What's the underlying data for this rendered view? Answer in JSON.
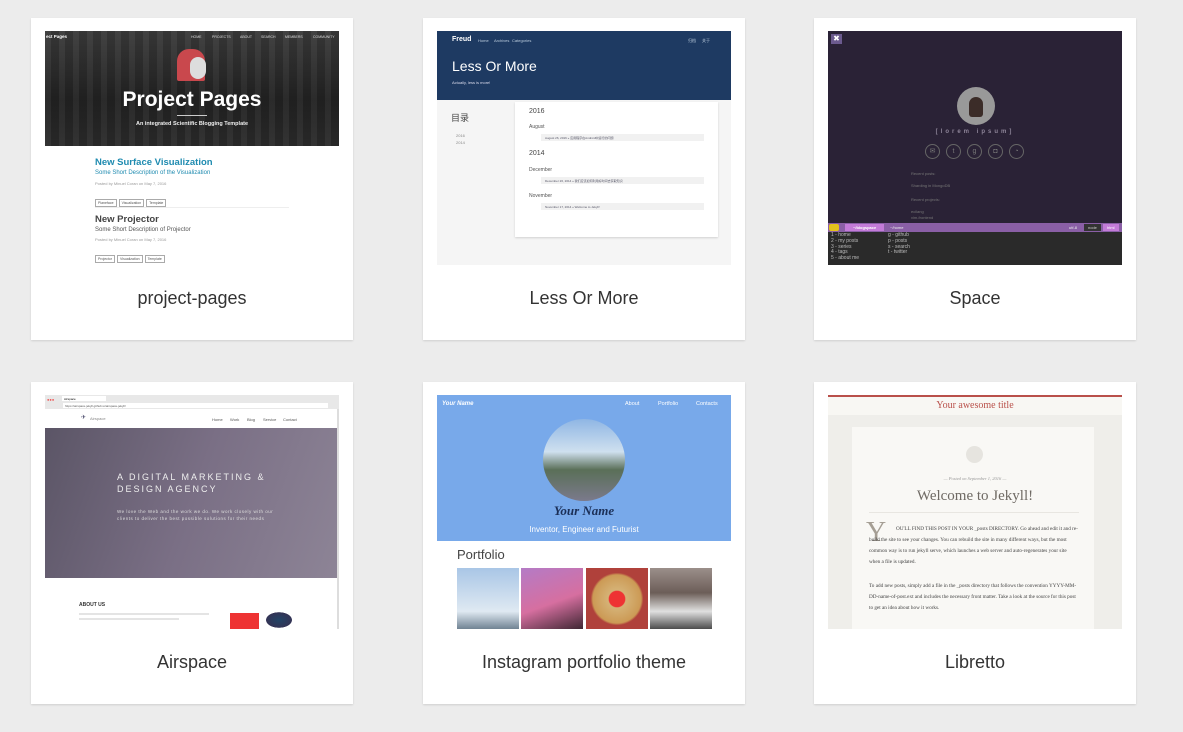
{
  "themes": [
    {
      "name": "project-pages",
      "thumb": {
        "site": "ect Pages",
        "nav": [
          "HOME",
          "PROJECTS",
          "ABOUT",
          "SEARCH",
          "MEMBERS",
          "COMMUNITY"
        ],
        "title": "Project Pages",
        "subtitle": "An integrated Scientific Blogging Template",
        "posts": [
          {
            "title": "New Surface Visualization",
            "desc": "Some Short Description of the Visualization",
            "meta": "Posted by Minuel Coran on May 7, 2016",
            "tags": [
              "Planeface",
              "Visualization",
              "Template"
            ]
          },
          {
            "title": "New Projector",
            "desc": "Some Short Description of Projector",
            "meta": "Posted by Minuel Coran on May 7, 2016",
            "tags": [
              "Projector",
              "Visualization",
              "Template"
            ]
          }
        ]
      }
    },
    {
      "name": "Less Or More",
      "thumb": {
        "brand": "Freud",
        "nav": [
          "Home",
          "Archives",
          "Categories"
        ],
        "nav_right": [
          "归档",
          "关于"
        ],
        "title": "Less Or More",
        "subtitle": "Actually, less is more!",
        "toc": "目录",
        "toc_items": [
          "2016",
          "2014"
        ],
        "years": [
          {
            "year": "2016",
            "months": [
              {
                "month": "August",
                "entry": "August 26, 2016 » 应用程序在Android中运行的问题"
              }
            ]
          },
          {
            "year": "2014",
            "months": [
              {
                "month": "December",
                "entry": "December 26, 2014 » 我们应该如何利用好时间去获取知识"
              },
              {
                "month": "November",
                "entry": "November 17, 2014 » Welcome to Jekyll!"
              }
            ]
          }
        ]
      }
    },
    {
      "name": "Space",
      "thumb": {
        "handle": "[lorem ipsum]",
        "recent_posts_label": "Recent posts:",
        "recent_posts": [
          "Sharding in MongoDB"
        ],
        "recent_projects_label": "Recent projects:",
        "recent_projects": [
          "ecilang",
          "vim-frontend"
        ],
        "status_left": "~/blogspace",
        "status_mid": "~/home",
        "status_right": [
          "utf-8",
          "node",
          "html"
        ],
        "menu_left": [
          "1 - home",
          "2 - my posts",
          "3 - series",
          "4 - tags",
          "5 - about me"
        ],
        "menu_right": [
          "g - github",
          "p - posts",
          "s - search",
          "t - twitter"
        ]
      }
    },
    {
      "name": "Airspace",
      "thumb": {
        "tab": "Airspace",
        "url": "https://airspace.jekyll.github.io/airspace-jekyll/",
        "brand": "Airspace",
        "nav": [
          "Home",
          "Work",
          "Blog",
          "Service",
          "Contact"
        ],
        "headline": "A DIGITAL MARKETING & DESIGN AGENCY",
        "body": "We love the Web and the work we do. We work closely with our clients to deliver the best possible solutions for their needs",
        "about": "ABOUT US"
      }
    },
    {
      "name": "Instagram portfolio theme",
      "thumb": {
        "brand": "Your Name",
        "nav": [
          "About",
          "Portfolio",
          "Contacts"
        ],
        "name": "Your Name",
        "tagline": "Inventor, Engineer and Futurist",
        "section": "Portfolio"
      }
    },
    {
      "name": "Libretto",
      "thumb": {
        "site_title": "Your awesome title",
        "posted": "— Posted on September 1, 2016 —",
        "post_title": "Welcome to Jekyll!",
        "p1": "OU'LL FIND THIS POST IN YOUR _posts DIRECTORY. Go ahead and edit it and re-build the site to see your changes. You can rebuild the site in many different ways, but the most common way is to run jekyll serve, which launches a web server and auto-regenerates your site when a file is updated.",
        "p2": "To add new posts, simply add a file in the _posts directory that follows the convention YYYY-MM-DD-name-of-post.ext and includes the necessary front matter. Take a look at the source for this post to get an idea about how it works."
      }
    }
  ]
}
